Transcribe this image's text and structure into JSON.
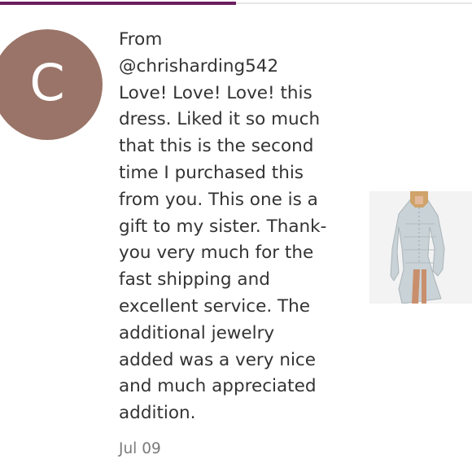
{
  "progress": {
    "percent": 50,
    "color": "#6c1e5e"
  },
  "avatar": {
    "letter": "C",
    "background_color": "#9a7468"
  },
  "review": {
    "from_label": "From",
    "username": "@chrisharding542",
    "text": "Love! Love! Love! this\ndress. Liked it so much\nthat this is the second\ntime I purchased this\nfrom you. This one is a\ngift to my sister. Thank-\nyou very much for the\nfast shipping and\nexcellent service. The\nadditional jewelry\nadded was a very nice\nand much appreciated\naddition.",
    "date": "Jul 09"
  },
  "product": {
    "icon": "dress-photo-thumbnail"
  }
}
